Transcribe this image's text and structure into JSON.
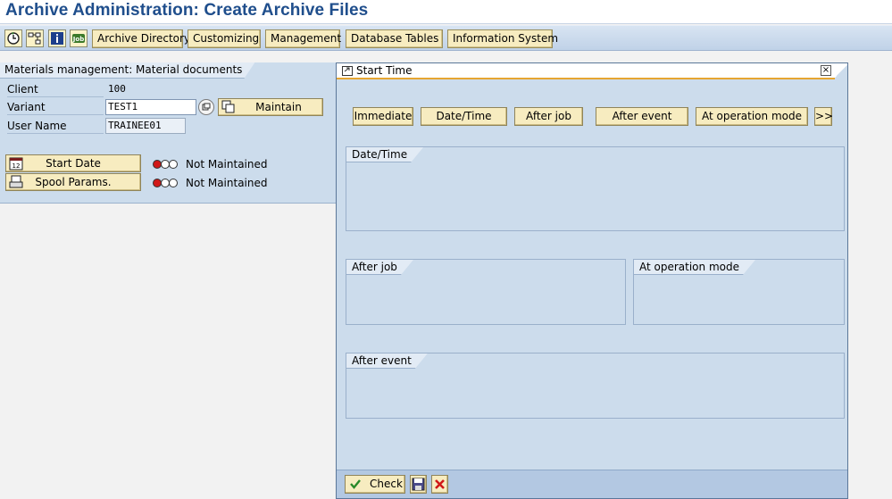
{
  "window": {
    "title": "Archive Administration: Create Archive Files"
  },
  "toolbar": {
    "icons": [
      "execute-icon",
      "hierarchy-icon",
      "info-icon",
      "job-icon"
    ],
    "buttons": [
      "Archive Directory",
      "Customizing",
      "Management",
      "Database Tables",
      "Information System"
    ]
  },
  "left_panel": {
    "group_title": "Materials management: Material documents",
    "fields": {
      "client_label": "Client",
      "client_value": "100",
      "variant_label": "Variant",
      "variant_value": "TEST1",
      "user_label": "User Name",
      "user_value": "TRAINEE01"
    },
    "maintain_button": "Maintain",
    "start_date_button": "Start Date",
    "start_date_status": "Not Maintained",
    "spool_button": "Spool Params.",
    "spool_status": "Not Maintained"
  },
  "dialog": {
    "title": "Start Time",
    "buttons": [
      "Immediate",
      "Date/Time",
      "After job",
      "After event",
      "At operation mode",
      ">>"
    ],
    "groups": {
      "date_time": "Date/Time",
      "after_job": "After job",
      "at_operation_mode": "At operation mode",
      "after_event": "After event"
    },
    "footer": {
      "check_button": "Check"
    }
  },
  "colors": {
    "title_blue": "#1f4e8c",
    "panel_blue": "#ccdcec",
    "button_yellow": "#f7ecc0",
    "status_red": "#d01818",
    "dialog_accent": "#e6a531"
  }
}
